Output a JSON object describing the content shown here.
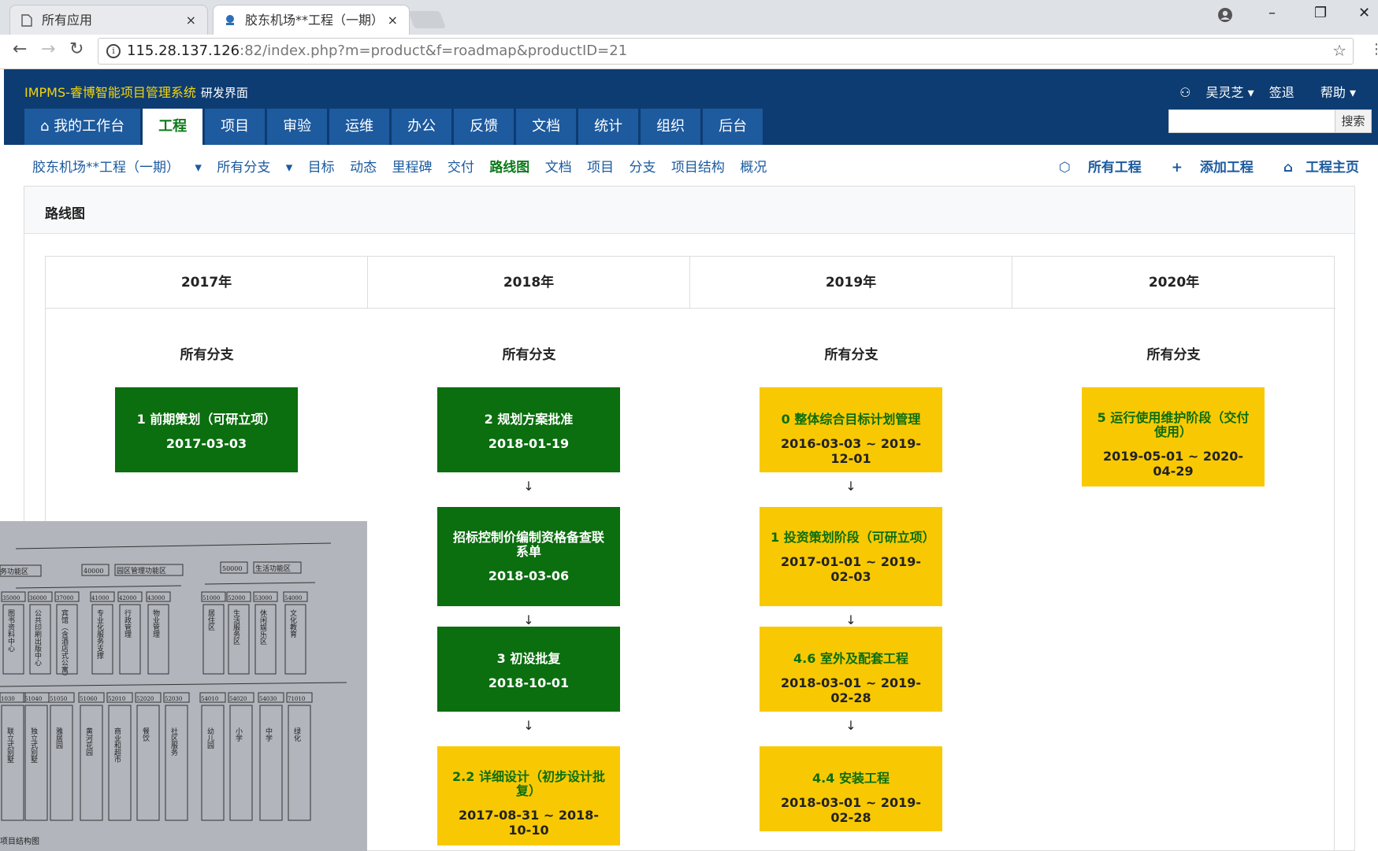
{
  "browser": {
    "tabs": [
      {
        "title": "所有应用",
        "close": "×"
      },
      {
        "title": "胶东机场**工程（一期）",
        "close": "×"
      }
    ],
    "url_host": "115.28.137.126",
    "url_port_path": ":82/index.php?m=product&f=roadmap&productID=21",
    "window_controls": [
      "–",
      "❐",
      "✕"
    ]
  },
  "app": {
    "brand": "IMPMS-睿博智能项目管理系统",
    "brand_sub": "研发界面",
    "user": "吴灵芝",
    "logout": "签退",
    "help": "帮助",
    "search_button": "搜索",
    "nav": [
      "我的工作台",
      "工程",
      "项目",
      "审验",
      "运维",
      "办公",
      "反馈",
      "文档",
      "统计",
      "组织",
      "后台"
    ],
    "active_nav": "工程"
  },
  "subnav": {
    "product": "胶东机场**工程（一期）",
    "branch": "所有分支",
    "items": [
      "目标",
      "动态",
      "里程碑",
      "交付",
      "路线图",
      "文档",
      "项目",
      "分支",
      "项目结构",
      "概况"
    ],
    "active": "路线图",
    "right": [
      "所有工程",
      "添加工程",
      "工程主页"
    ]
  },
  "panel": {
    "title": "路线图"
  },
  "roadmap": {
    "years": [
      "2017年",
      "2018年",
      "2019年",
      "2020年"
    ],
    "branch_label": "所有分支",
    "columns": [
      [
        {
          "title": "1 前期策划（可研立项）",
          "date": "2017-03-03",
          "color": "green"
        }
      ],
      [
        {
          "title": "2 规划方案批准",
          "date": "2018-01-19",
          "color": "green"
        },
        {
          "title": "招标控制价编制资格备查联系单",
          "date": "2018-03-06",
          "color": "green"
        },
        {
          "title": "3 初设批复",
          "date": "2018-10-01",
          "color": "green"
        },
        {
          "title": "2.2 详细设计（初步设计批复）",
          "date": "2017-08-31 ~ 2018-10-10",
          "color": "yellow"
        }
      ],
      [
        {
          "title": "0 整体综合目标计划管理",
          "date": "2016-03-03 ~ 2019-12-01",
          "color": "yellow"
        },
        {
          "title": "1 投资策划阶段（可研立项）",
          "date": "2017-01-01 ~ 2019-02-03",
          "color": "yellow"
        },
        {
          "title": "4.6 室外及配套工程",
          "date": "2018-03-01 ~ 2019-02-28",
          "color": "yellow"
        },
        {
          "title": "4.4 安装工程",
          "date": "2018-03-01 ~ 2019-02-28",
          "color": "yellow"
        }
      ],
      [
        {
          "title": "5 运行使用维护阶段（交付使用）",
          "date": "2019-05-01 ~ 2020-04-29",
          "color": "yellow"
        }
      ]
    ],
    "arrow": "↓"
  },
  "photo": {
    "top_codes": [
      "40000",
      "园区管理功能区",
      "50000",
      "生活功能区",
      "务功能区"
    ],
    "mid_codes": [
      "35000",
      "36000",
      "37000",
      "41000",
      "42000",
      "43000",
      "51000",
      "52000",
      "53000",
      "54000"
    ],
    "mid_labels": [
      "图书资料中心",
      "公共印刷出版中心",
      "宾馆（含酒店式公寓）",
      "专业化服务支撑",
      "行政管理",
      "物业管理",
      "居住区",
      "生活服务区",
      "休闲娱乐区",
      "文化教育"
    ],
    "bottom_codes": [
      "1030",
      "51040",
      "51050",
      "51060",
      "52010",
      "52020",
      "52030",
      "54010",
      "54020",
      "54030",
      "71010"
    ],
    "bottom_labels": [
      "联立式别墅",
      "独立式别墅",
      "雅居园",
      "黄河花园",
      "商业和超市",
      "餐饮",
      "社区服务",
      "幼儿园",
      "小学",
      "中学",
      "绿化"
    ],
    "caption": "项目结构图"
  }
}
